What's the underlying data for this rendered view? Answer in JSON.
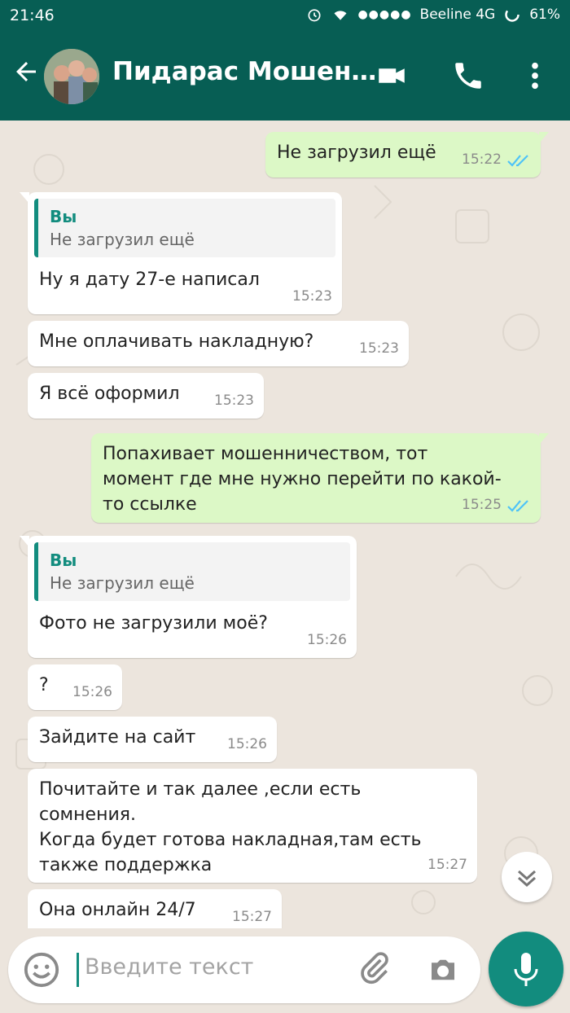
{
  "status_bar": {
    "time": "21:46",
    "carrier": "Beeline 4G",
    "battery": "61%",
    "signal_dots": "●●●●●"
  },
  "header": {
    "title": "Пидарас Мошен…",
    "icons": [
      "back-arrow-icon",
      "video-call-icon",
      "phone-icon",
      "more-vert-icon"
    ]
  },
  "messages": [
    {
      "dir": "out",
      "text": "Не загрузил ещё",
      "time": "15:22",
      "read": true
    },
    {
      "dir": "in",
      "quote_name": "Вы",
      "quote_text": "Не загрузил ещё",
      "text": "Ну я дату 27-е написал",
      "time": "15:23"
    },
    {
      "dir": "in",
      "text": "Мне оплачивать накладную?",
      "time": "15:23"
    },
    {
      "dir": "in",
      "text": "Я всё оформил",
      "time": "15:23"
    },
    {
      "dir": "out",
      "text": "Попахивает мошенничеством, тот\nмомент где мне нужно перейти по какой-\nто ссылке",
      "time": "15:25",
      "read": true
    },
    {
      "dir": "in",
      "quote_name": "Вы",
      "quote_text": "Не загрузил ещё",
      "text": "Фото не загрузили моё?",
      "time": "15:26"
    },
    {
      "dir": "in",
      "text": "?",
      "time": "15:26"
    },
    {
      "dir": "in",
      "text": "Зайдите на сайт",
      "time": "15:26"
    },
    {
      "dir": "in",
      "text": "Почитайте и так далее ,если есть\nсомнения.\nКогда будет готова накладная,там есть\nтакже поддержка",
      "time": "15:27"
    },
    {
      "dir": "in",
      "text": "Она онлайн 24/7",
      "time": "15:27"
    }
  ],
  "composer": {
    "placeholder": "Введите текст"
  },
  "colors": {
    "header": "#075e54",
    "accent": "#128c7e",
    "outgoing_bubble": "#dcf8c6",
    "incoming_bubble": "#ffffff",
    "chat_background": "#ece5dd",
    "read_ticks": "#4fc3f7"
  }
}
